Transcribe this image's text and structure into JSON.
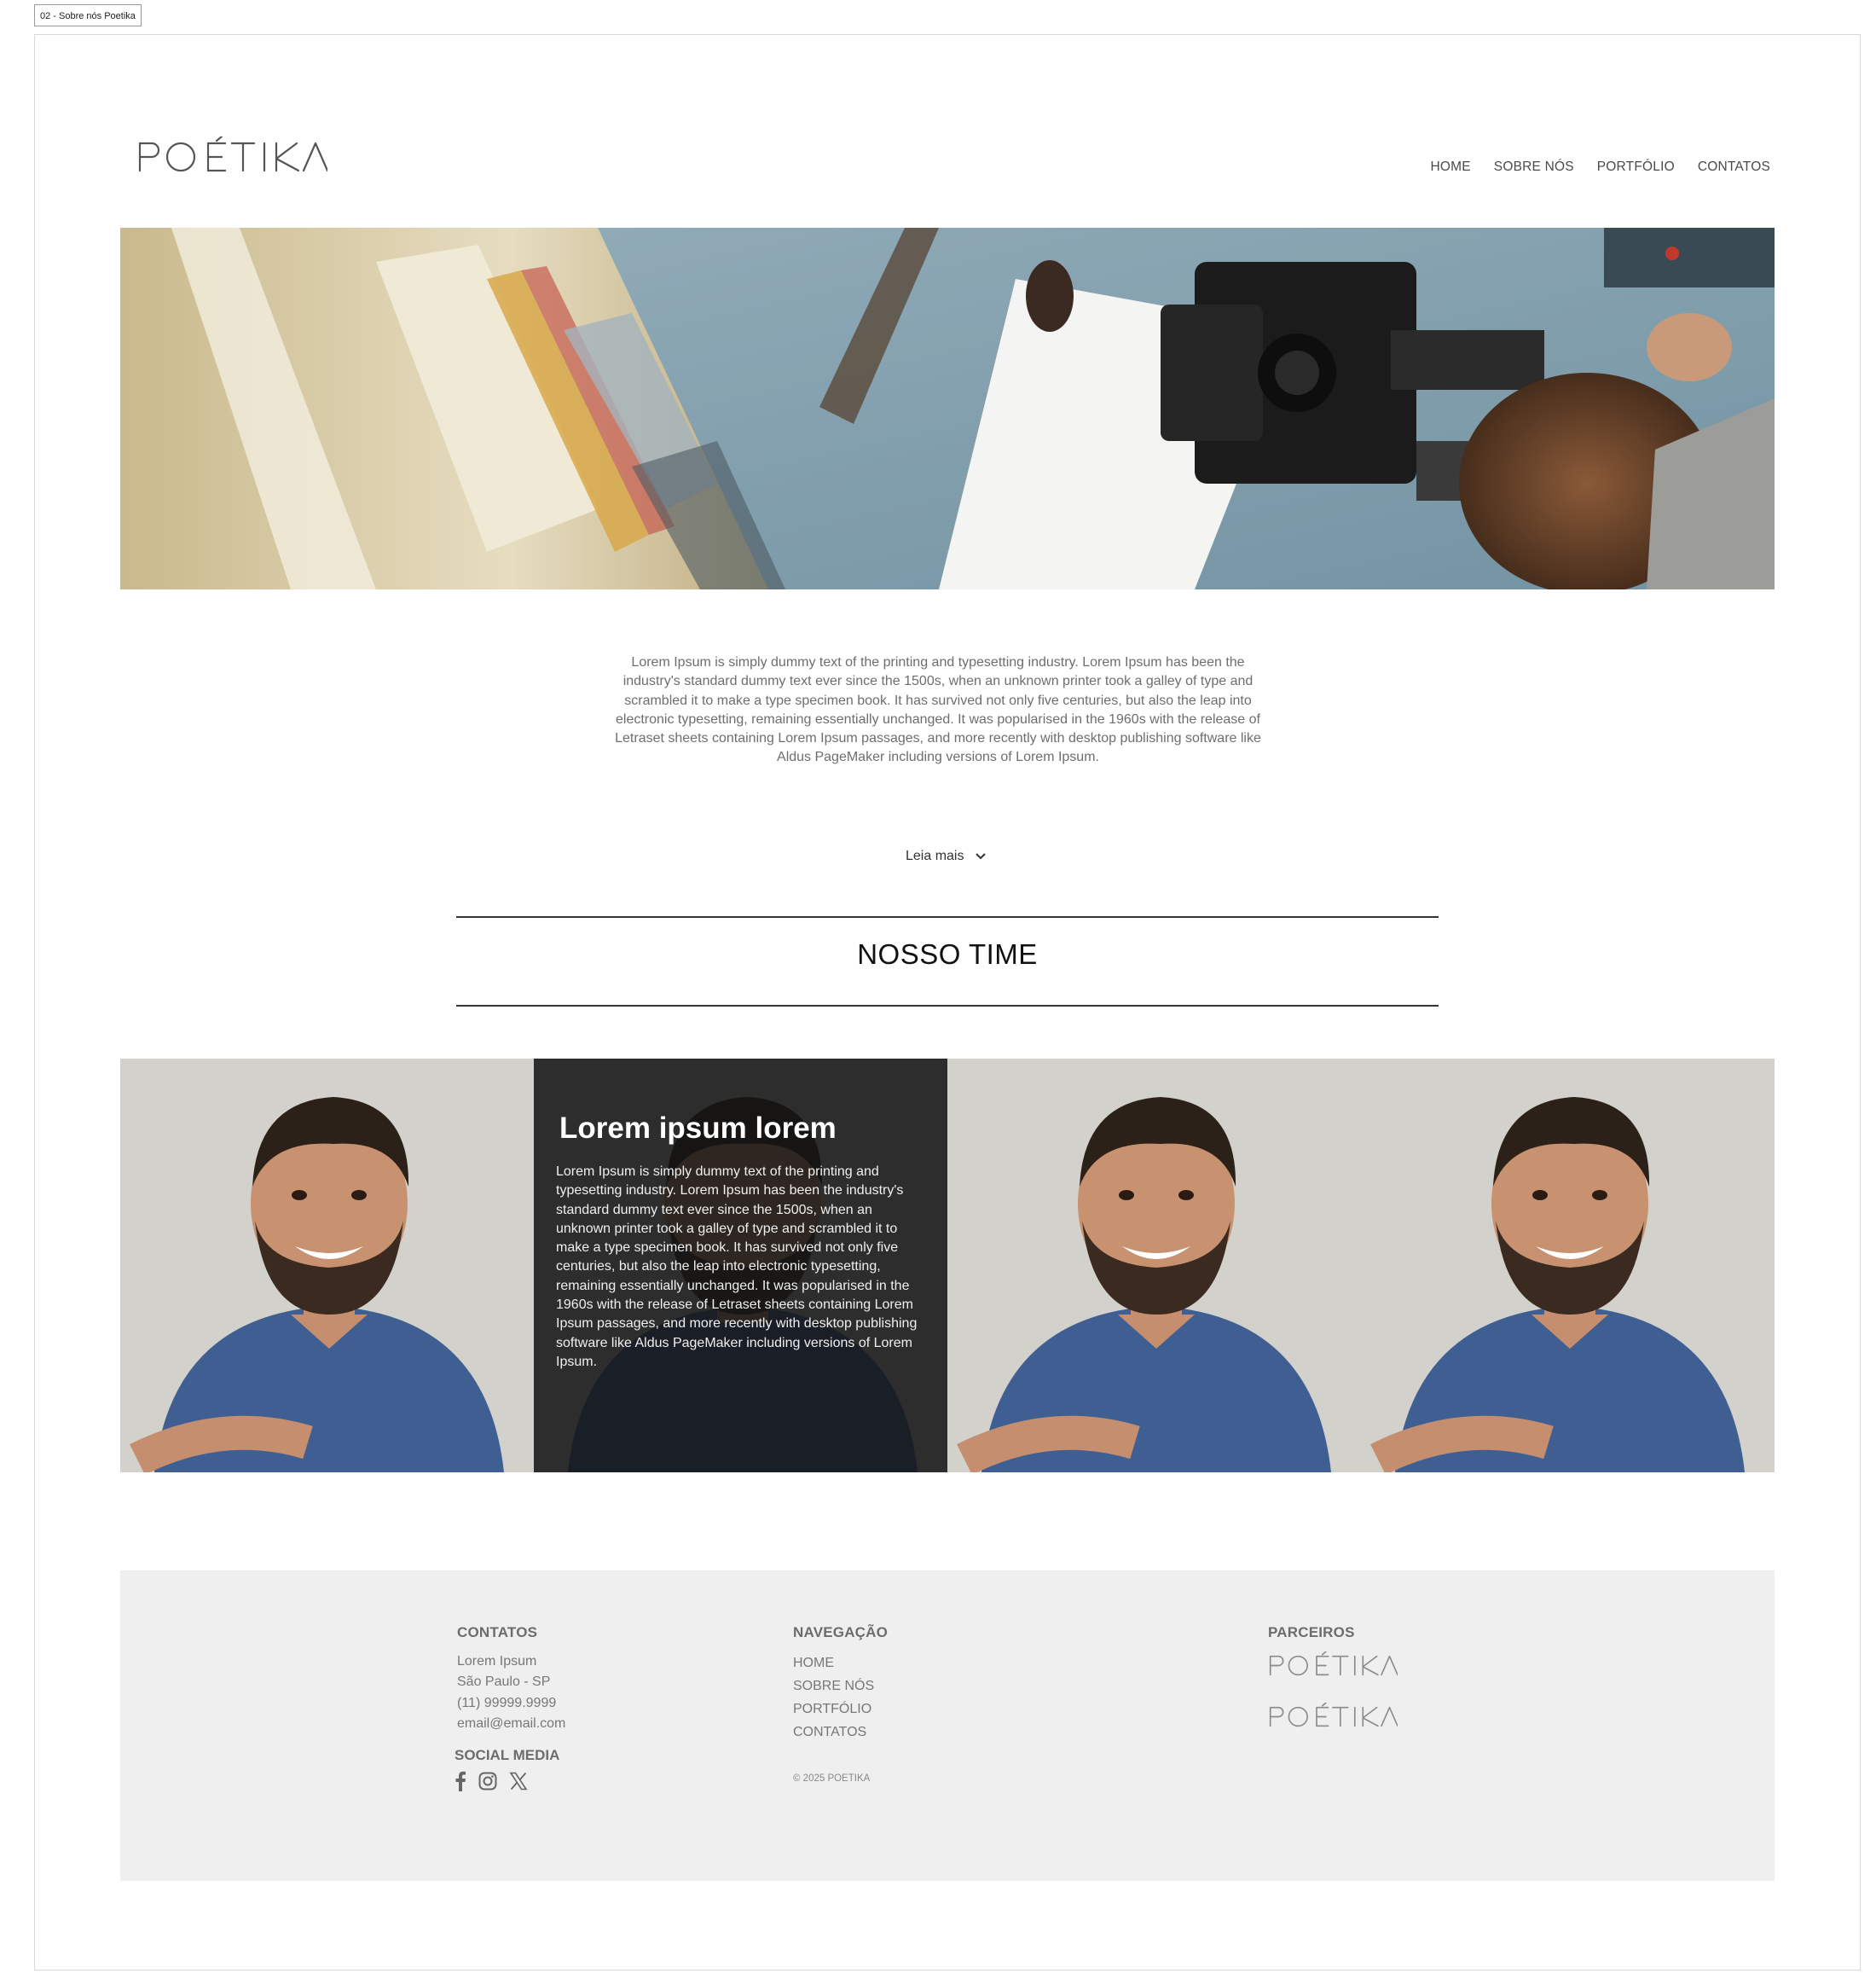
{
  "frame": {
    "label": "02 - Sobre nós Poetika"
  },
  "brand": {
    "logo_text": "POÉTIKA"
  },
  "nav": {
    "items": [
      "HOME",
      "SOBRE NÓS",
      "PORTFÓLIO",
      "CONTATOS"
    ]
  },
  "intro": {
    "text": "Lorem Ipsum is simply dummy text of the printing and typesetting industry. Lorem Ipsum has been the industry's standard dummy text ever since the 1500s, when an unknown printer took a galley of type and scrambled it to make a type specimen book. It has survived not only five centuries, but also the leap into electronic typesetting, remaining essentially unchanged. It was popularised in the 1960s with the release of Letraset sheets containing Lorem Ipsum passages, and more recently with desktop publishing software like Aldus PageMaker including versions of Lorem Ipsum.",
    "read_more": "Leia mais"
  },
  "team": {
    "title": "NOSSO TIME",
    "highlight": {
      "name": "Lorem ipsum lorem",
      "bio": "Lorem Ipsum is simply dummy text of the printing and typesetting industry. Lorem Ipsum has been the industry's standard dummy text ever since the 1500s, when an unknown printer took a galley of type and scrambled it to make a type specimen book. It has survived not only five centuries, but also the leap into electronic typesetting, remaining essentially unchanged. It was popularised in the 1960s with the release of Letraset sheets containing Lorem Ipsum passages, and more recently with desktop publishing software like Aldus PageMaker including versions of Lorem Ipsum."
    }
  },
  "footer": {
    "contacts": {
      "title": "CONTATOS",
      "lines": [
        "Lorem Ipsum",
        "São Paulo - SP",
        "(11) 99999.9999",
        "email@email.com"
      ]
    },
    "social": {
      "title": "SOCIAL MEDIA",
      "icons": [
        "facebook-icon",
        "instagram-icon",
        "x-icon"
      ]
    },
    "navigation": {
      "title": "NAVEGAÇÃO",
      "items": [
        "HOME",
        "SOBRE NÓS",
        "PORTFÓLIO",
        "CONTATOS"
      ],
      "copyright": "© 2025 POETIKA"
    },
    "partners": {
      "title": "PARCEIROS",
      "logos": [
        "POÉTIKA",
        "POÉTIKA"
      ]
    }
  },
  "colors": {
    "footer_bg": "#efefef",
    "overlay_bg": "#1e1e1e",
    "text_muted": "#6e6e6e"
  }
}
